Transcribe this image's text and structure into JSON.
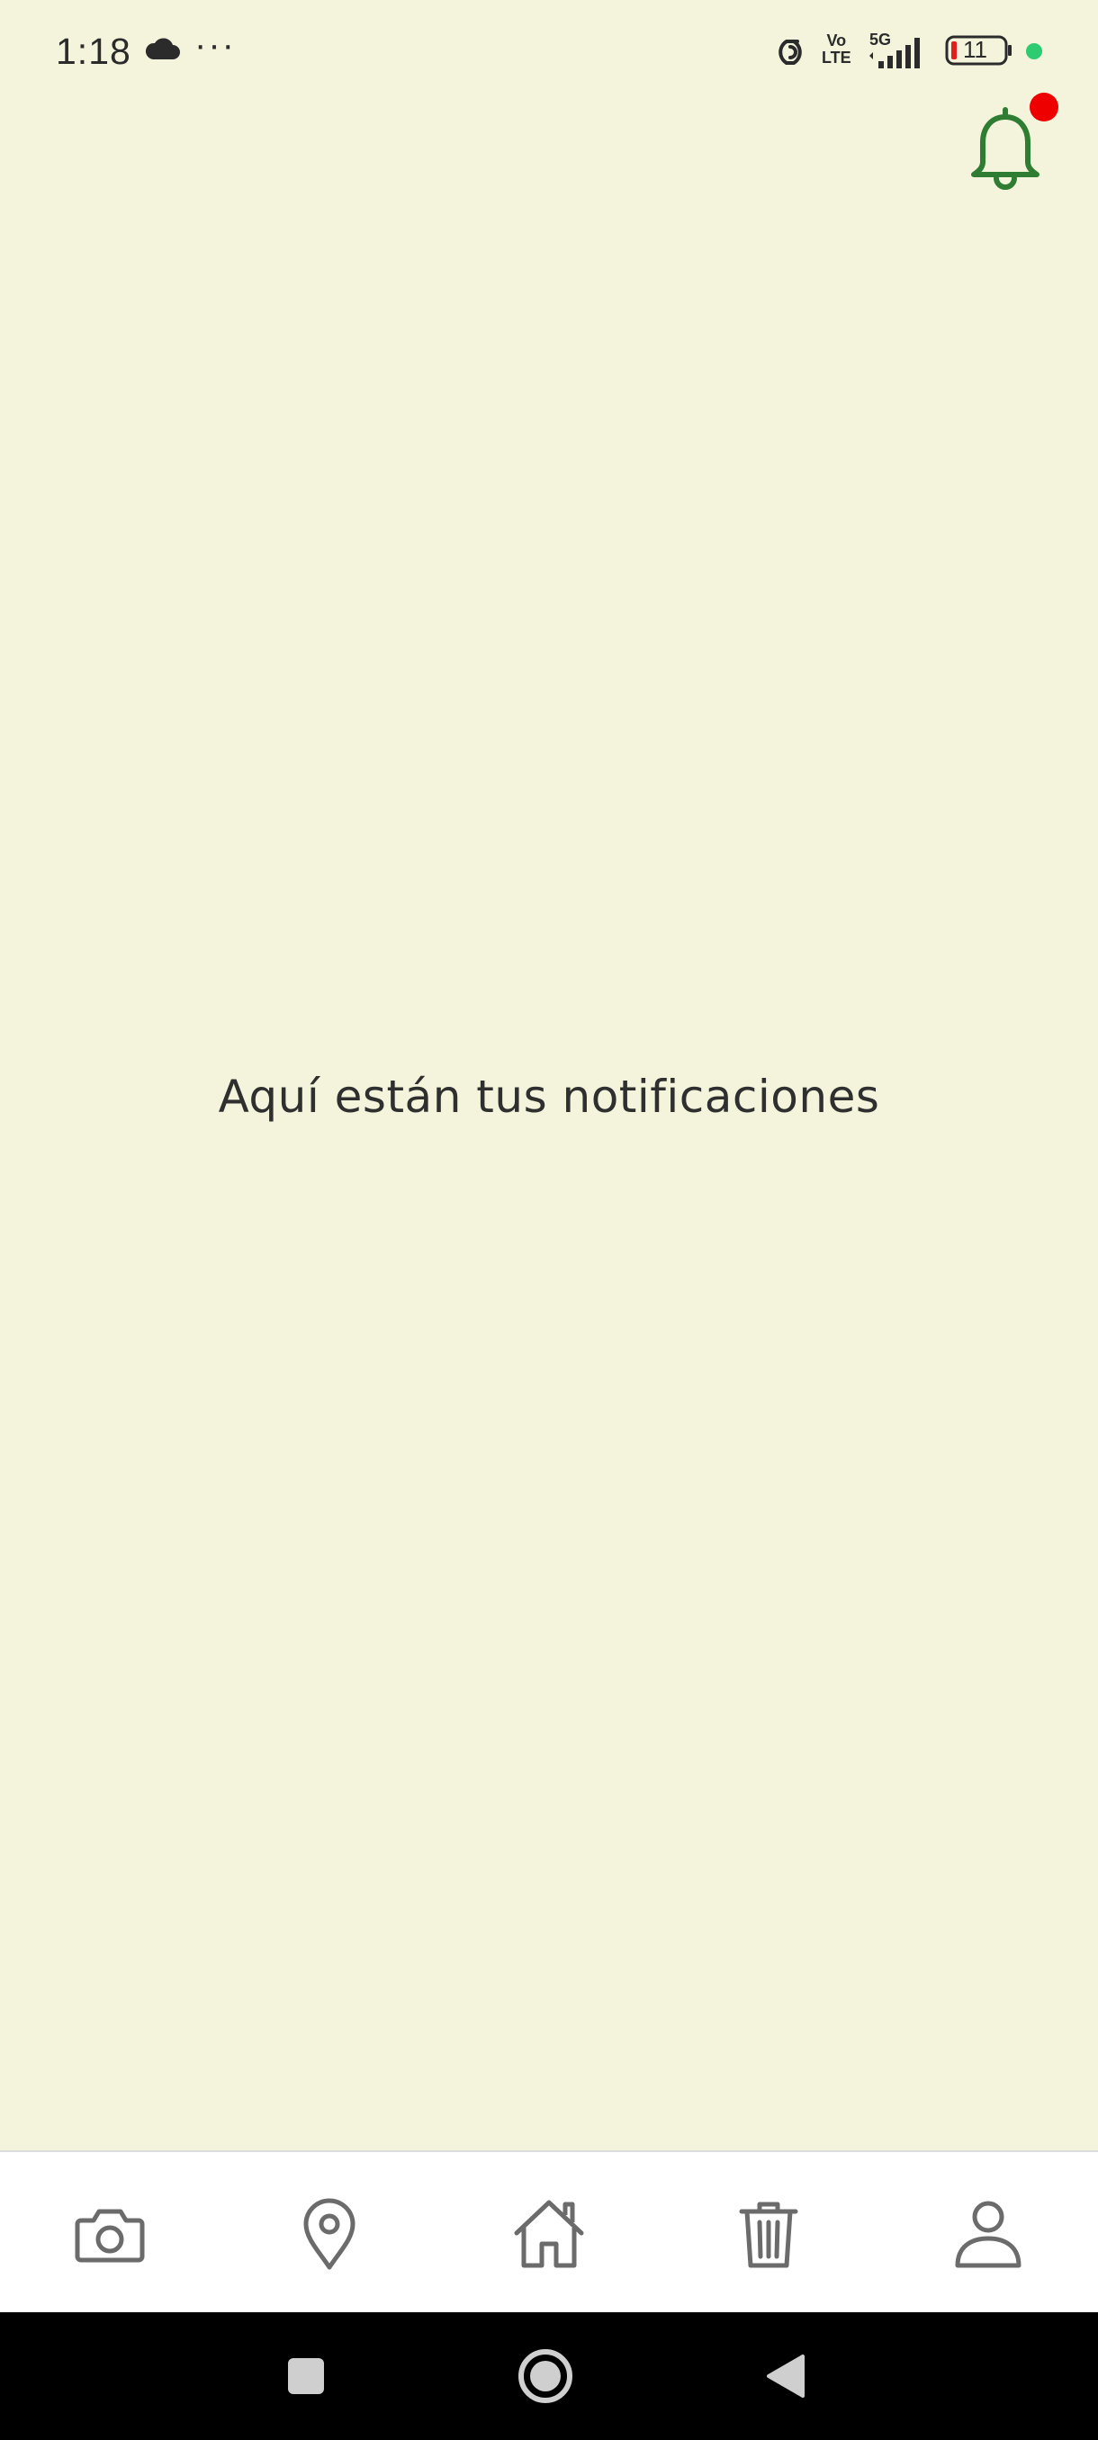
{
  "status_bar": {
    "time": "1:18",
    "more": "···",
    "volte_top": "Vo",
    "volte_bottom": "LTE",
    "network": "5G",
    "battery": "11"
  },
  "header": {
    "bell_icon": "bell-icon",
    "has_unread_badge": true,
    "accent_color": "#2e7d32",
    "badge_color": "#ee0000"
  },
  "main": {
    "message": "Aquí están tus notificaciones"
  },
  "bottom_nav": {
    "items": [
      {
        "icon": "camera-icon"
      },
      {
        "icon": "location-pin-icon"
      },
      {
        "icon": "home-icon"
      },
      {
        "icon": "trash-icon"
      },
      {
        "icon": "user-icon"
      }
    ],
    "icon_color": "#6b6b6b"
  },
  "system_nav": {
    "items": [
      {
        "icon": "square-recents-icon"
      },
      {
        "icon": "circle-home-icon"
      },
      {
        "icon": "triangle-back-icon"
      }
    ]
  },
  "colors": {
    "background": "#f4f4dc",
    "nav_background": "#ffffff",
    "system_bar": "#000000"
  }
}
